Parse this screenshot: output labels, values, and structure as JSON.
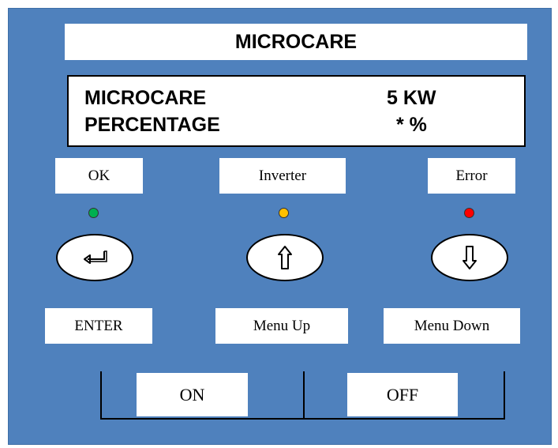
{
  "header": {
    "title": "MICROCARE"
  },
  "display": {
    "row1_label": "MICROCARE",
    "row1_value": "5 KW",
    "row2_label": "PERCENTAGE",
    "row2_value": "* %"
  },
  "indicators": [
    {
      "label": "OK",
      "color": "#00b050",
      "icon": "led-green"
    },
    {
      "label": "Inverter",
      "color": "#ffc000",
      "icon": "led-yellow"
    },
    {
      "label": "Error",
      "color": "#ff0000",
      "icon": "led-red"
    }
  ],
  "buttons": [
    {
      "label": "ENTER",
      "icon": "enter-icon"
    },
    {
      "label": "Menu Up",
      "icon": "arrow-up-icon"
    },
    {
      "label": "Menu Down",
      "icon": "arrow-down-icon"
    }
  ],
  "power": {
    "on_label": "ON",
    "off_label": "OFF"
  },
  "colors": {
    "panel_background": "#4f81bd"
  }
}
